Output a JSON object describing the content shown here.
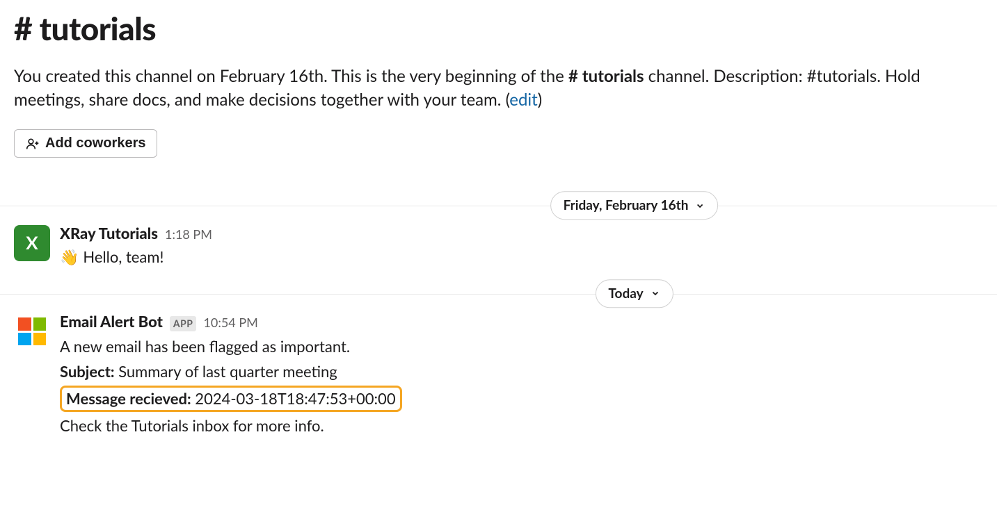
{
  "channel": {
    "name": "tutorials",
    "hash": "#",
    "description_prefix": "You created this channel on February 16th. This is the very beginning of the ",
    "description_channel": "# tutorials",
    "description_suffix1": " channel. Description: #tutorials. Hold meetings, share docs, and make decisions together with your team. (",
    "edit_label": "edit",
    "description_suffix2": ")",
    "add_coworkers_label": "Add coworkers"
  },
  "dividers": {
    "first_date": "Friday, February 16th",
    "second_date": "Today"
  },
  "messages": [
    {
      "sender": "XRay Tutorials",
      "avatar_letter": "X",
      "time": "1:18 PM",
      "wave": "👋",
      "text": "Hello, team!"
    },
    {
      "sender": "Email Alert Bot",
      "badge": "APP",
      "time": "10:54 PM",
      "line1": "A new email has been flagged as important.",
      "subject_label": "Subject:",
      "subject_value": " Summary of last quarter meeting",
      "received_label": "Message recieved:",
      "received_value": " 2024-03-18T18:47:53+00:00",
      "line_last": "Check the Tutorials inbox for more info."
    }
  ]
}
